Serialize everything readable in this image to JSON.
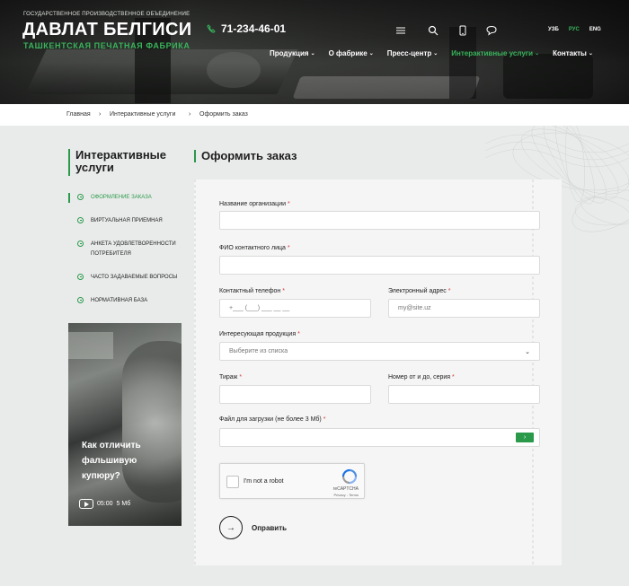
{
  "header": {
    "org_top": "Государственное производственное объединение",
    "logo_main": "ДАВЛАТ БЕЛГИСИ",
    "logo_sub": "ТАШКЕНТСКАЯ ПЕЧАТНАЯ ФАБРИКА",
    "phone": "71-234-46-01",
    "icons": [
      "list-icon",
      "search-icon",
      "mobile-icon",
      "chat-icon"
    ],
    "languages": [
      "УЗБ",
      "РУС",
      "ENG"
    ],
    "active_language": "РУС",
    "nav": [
      {
        "label": "Продукция"
      },
      {
        "label": "О фабрике"
      },
      {
        "label": "Пресс-центр"
      },
      {
        "label": "Интерактивные услуги"
      },
      {
        "label": "Контакты"
      }
    ]
  },
  "breadcrumb": [
    "Главная",
    "Интерактивные услуги",
    "Оформить заказ"
  ],
  "sidebar": {
    "title": "Интерактивные услуги",
    "items": [
      {
        "label": "Оформление заказа"
      },
      {
        "label": "Виртуальная приемная"
      },
      {
        "label": "Анкета удовлетворенности потребителя"
      },
      {
        "label": "Часто задаваемые вопросы"
      },
      {
        "label": "Нормативная база"
      }
    ],
    "promo": {
      "text": "Как отличить фальшивую купюру?",
      "duration": "05:00",
      "size": "5 Мб"
    }
  },
  "main": {
    "title": "Оформить заказ",
    "form": {
      "org_label": "Название организации",
      "contact_label": "ФИО контактного лица",
      "phone_label": "Контактный телефон",
      "phone_placeholder": "+___ (___) ___ __ __",
      "email_label": "Электронный адрес",
      "email_placeholder": "my@site.uz",
      "product_label": "Интересующая продукция",
      "product_placeholder": "Выберите из списка",
      "circulation_label": "Тираж",
      "number_label": "Номер от и до, серия",
      "file_label": "Файл для загрузки (не более 3 Мб)",
      "required_mark": "*",
      "captcha_text": "I'm not a robot",
      "captcha_brand": "reCAPTCHA",
      "captcha_links": "Privacy - Terms",
      "submit_label": "Оправить"
    }
  },
  "colors": {
    "accent": "#2a9a4a",
    "page_bg": "#e9ebea",
    "form_bg": "#f4f5f4"
  }
}
